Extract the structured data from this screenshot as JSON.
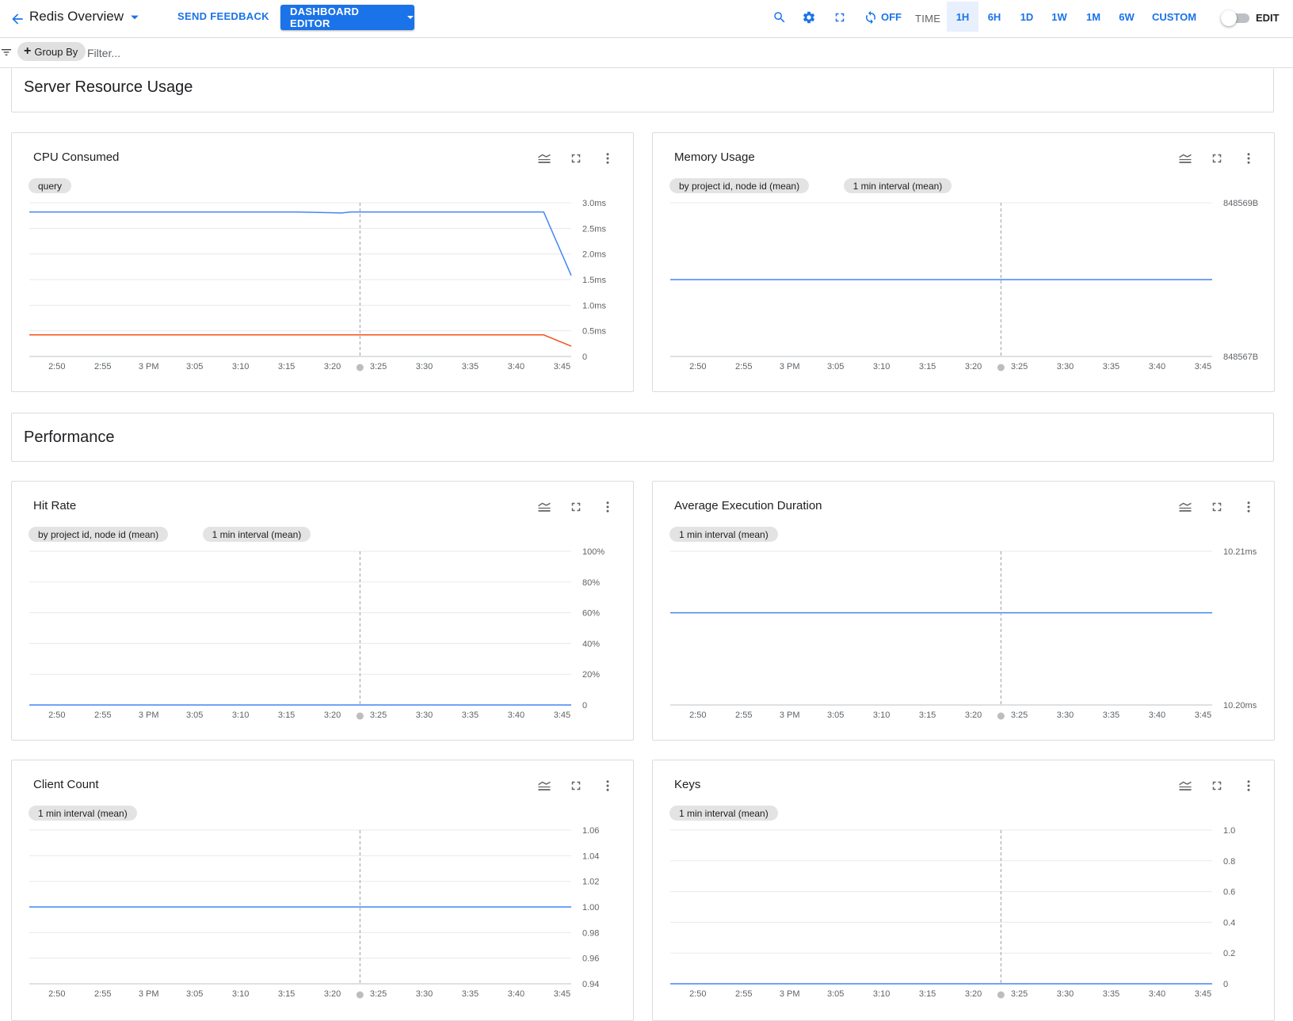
{
  "header": {
    "title": "Redis Overview",
    "send_feedback": "SEND FEEDBACK",
    "dashboard_editor": "DASHBOARD EDITOR",
    "refresh_label": "OFF",
    "time_label": "TIME",
    "ranges": [
      "1H",
      "6H",
      "1D",
      "1W",
      "1M",
      "6W",
      "CUSTOM"
    ],
    "active_range": "1H",
    "edit_label": "EDIT"
  },
  "filter": {
    "group_by": "Group By",
    "placeholder": "Filter..."
  },
  "sections": {
    "server": "Server Resource Usage",
    "performance": "Performance"
  },
  "colors": {
    "accent": "#1a73e8",
    "series_blue": "#4285f4",
    "series_orange": "#f4511e",
    "grid": "#e8eaed"
  },
  "icons": {
    "back": "arrow-back-icon",
    "search": "search-icon",
    "settings": "gear-icon",
    "fullscreen": "fullscreen-icon",
    "refresh": "refresh-icon",
    "legend": "legend-icon",
    "expand": "expand-icon",
    "more": "more-vert-icon",
    "filter": "filter-list-icon"
  },
  "x_ticks": [
    "2:50",
    "2:55",
    "3 PM",
    "3:05",
    "3:10",
    "3:15",
    "3:20",
    "3:25",
    "3:30",
    "3:35",
    "3:40",
    "3:45"
  ],
  "chart_data": [
    {
      "type": "line",
      "title": "CPU Consumed",
      "chips": [
        "query"
      ],
      "y_ticks": [
        "3.0ms",
        "2.5ms",
        "2.0ms",
        "1.5ms",
        "1.0ms",
        "0.5ms",
        "0"
      ],
      "ylim": [
        0,
        3.0
      ],
      "y_unit": "ms",
      "x": [
        "2:47",
        "3:16",
        "3:21",
        "3:22",
        "3:43",
        "3:46"
      ],
      "series": [
        {
          "color": "#4285f4",
          "values": [
            2.82,
            2.82,
            2.8,
            2.82,
            2.82,
            1.58
          ]
        },
        {
          "color": "#f4511e",
          "values": [
            0.42,
            0.42,
            0.42,
            0.42,
            0.42,
            0.2
          ]
        }
      ],
      "cursor": "3:23"
    },
    {
      "type": "line",
      "title": "Memory Usage",
      "chips": [
        "by project id, node id (mean)",
        "1 min interval (mean)"
      ],
      "y_ticks": [
        "848569B",
        "848567B"
      ],
      "ylim": [
        848567,
        848569
      ],
      "y_unit": "B",
      "x": [
        "2:47",
        "3:46"
      ],
      "series": [
        {
          "color": "#4285f4",
          "values": [
            848568,
            848568
          ]
        }
      ],
      "cursor": "3:23"
    },
    {
      "type": "line",
      "title": "Hit Rate",
      "chips": [
        "by project id, node id (mean)",
        "1 min interval (mean)"
      ],
      "y_ticks": [
        "100%",
        "80%",
        "60%",
        "40%",
        "20%",
        "0"
      ],
      "ylim": [
        0,
        100
      ],
      "y_unit": "%",
      "x": [
        "2:47",
        "3:46"
      ],
      "series": [
        {
          "color": "#4285f4",
          "values": [
            0,
            0
          ]
        }
      ],
      "cursor": "3:23"
    },
    {
      "type": "line",
      "title": "Average Execution Duration",
      "chips": [
        "1 min interval (mean)"
      ],
      "y_ticks": [
        "10.21ms",
        "10.20ms"
      ],
      "ylim": [
        10.2,
        10.21
      ],
      "y_unit": "ms",
      "x": [
        "2:47",
        "3:46"
      ],
      "series": [
        {
          "color": "#4285f4",
          "values": [
            10.206,
            10.206
          ]
        }
      ],
      "cursor": "3:23"
    },
    {
      "type": "line",
      "title": "Client Count",
      "chips": [
        "1 min interval (mean)"
      ],
      "y_ticks": [
        "1.06",
        "1.04",
        "1.02",
        "1.00",
        "0.98",
        "0.96",
        "0.94"
      ],
      "ylim": [
        0.94,
        1.06
      ],
      "x": [
        "2:47",
        "3:46"
      ],
      "series": [
        {
          "color": "#4285f4",
          "values": [
            1.0,
            1.0
          ]
        }
      ],
      "cursor": "3:23"
    },
    {
      "type": "line",
      "title": "Keys",
      "chips": [
        "1 min interval (mean)"
      ],
      "y_ticks": [
        "1.0",
        "0.8",
        "0.6",
        "0.4",
        "0.2",
        "0"
      ],
      "ylim": [
        0,
        1.0
      ],
      "x": [
        "2:47",
        "3:46"
      ],
      "series": [
        {
          "color": "#4285f4",
          "values": [
            0,
            0
          ]
        }
      ],
      "cursor": "3:23"
    }
  ]
}
